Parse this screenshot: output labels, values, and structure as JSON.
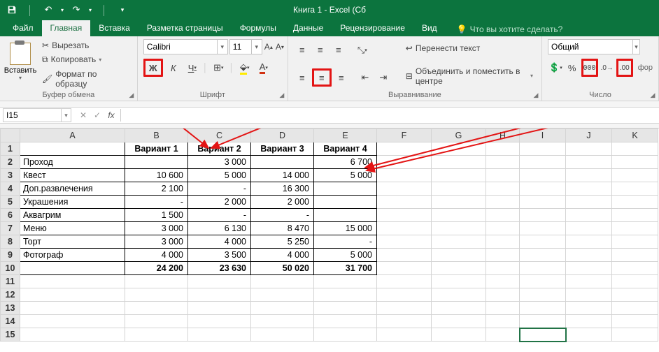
{
  "title": "Книга 1 - Excel (Сб",
  "tabs": {
    "file": "Файл",
    "home": "Главная",
    "insert": "Вставка",
    "layout": "Разметка страницы",
    "formulas": "Формулы",
    "data": "Данные",
    "review": "Рецензирование",
    "view": "Вид"
  },
  "tellme_placeholder": "Что вы хотите сделать?",
  "ribbon": {
    "clipboard": {
      "paste": "Вставить",
      "cut": "Вырезать",
      "copy": "Копировать",
      "painter": "Формат по образцу",
      "label": "Буфер обмена"
    },
    "font": {
      "name": "Calibri",
      "size": "11",
      "label": "Шрифт",
      "bold": "Ж",
      "italic": "К",
      "underline": "Ч"
    },
    "align": {
      "wrap": "Перенести текст",
      "merge": "Объединить и поместить в центре",
      "label": "Выравнивание"
    },
    "number": {
      "format": "Общий",
      "label": "Число",
      "sep": "000",
      "dec": "фор"
    }
  },
  "namebox": "I15",
  "cols": [
    "A",
    "B",
    "C",
    "D",
    "E",
    "F",
    "G",
    "H",
    "I",
    "J",
    "K"
  ],
  "headers": {
    "b": "Вариант 1",
    "c": "Вариант 2",
    "d": "Вариант 3",
    "e": "Вариант 4"
  },
  "rows": [
    {
      "a": "Проход",
      "b": "",
      "c": "3 000",
      "d": "",
      "e": "6 700"
    },
    {
      "a": "Квест",
      "b": "10 600",
      "c": "5 000",
      "d": "14 000",
      "e": "5 000"
    },
    {
      "a": "Доп.развлечения",
      "b": "2 100",
      "c": "-",
      "d": "16 300",
      "e": ""
    },
    {
      "a": "Украшения",
      "b": "-",
      "c": "2 000",
      "d": "2 000",
      "e": ""
    },
    {
      "a": "Аквагрим",
      "b": "1 500",
      "c": "-",
      "d": "-",
      "e": ""
    },
    {
      "a": "Меню",
      "b": "3 000",
      "c": "6 130",
      "d": "8 470",
      "e": "15 000"
    },
    {
      "a": "Торт",
      "b": "3 000",
      "c": "4 000",
      "d": "5 250",
      "e": "-"
    },
    {
      "a": "Фотограф",
      "b": "4 000",
      "c": "3 500",
      "d": "4 000",
      "e": "5 000"
    }
  ],
  "totals": {
    "b": "24 200",
    "c": "23 630",
    "d": "50 020",
    "e": "31 700"
  }
}
